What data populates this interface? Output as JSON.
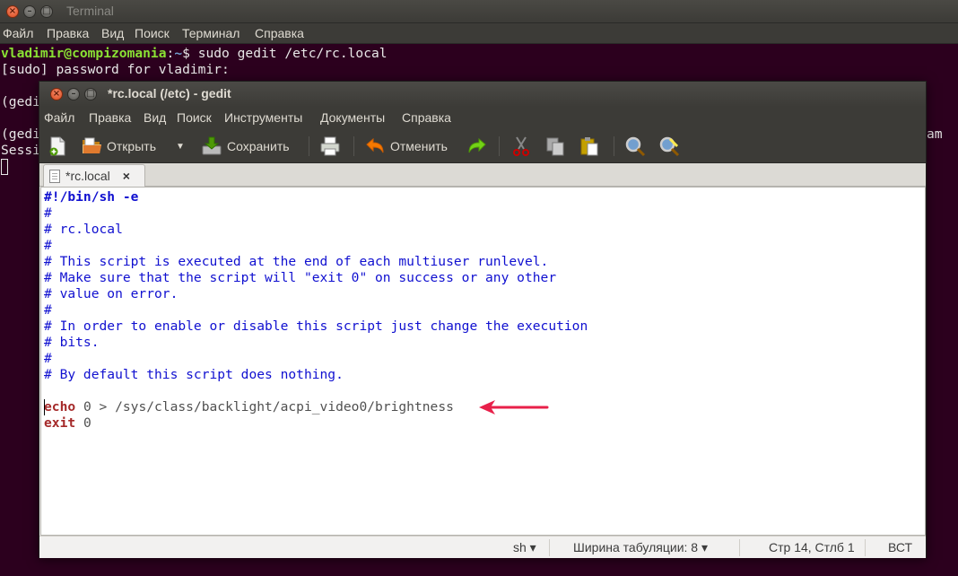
{
  "terminal": {
    "title": "Terminal",
    "menu": [
      "Файл",
      "Правка",
      "Вид",
      "Поиск",
      "Терминал",
      "Справка"
    ],
    "prompt_user": "vladimir@compizomania",
    "prompt_sep": ":",
    "prompt_path": "~",
    "prompt_sym": "$",
    "command": " sudo gedit /etc/rc.local",
    "line2": "[sudo] password for vladimir:",
    "line4": "(gedi",
    "line6": "(gedi",
    "line7": "Sessi",
    "right_fragment": "am"
  },
  "gedit": {
    "title": "*rc.local (/etc) - gedit",
    "menu": [
      "Файл",
      "Правка",
      "Вид",
      "Поиск",
      "Инструменты",
      "Документы",
      "Справка"
    ],
    "toolbar": {
      "open_label": "Открыть",
      "save_label": "Сохранить",
      "undo_label": "Отменить"
    },
    "tab_label": "*rc.local",
    "tab_close": "×",
    "code": {
      "l1": "#!/bin/sh -e",
      "l2": "#",
      "l3": "# rc.local",
      "l4": "#",
      "l5": "# This script is executed at the end of each multiuser runlevel.",
      "l6": "# Make sure that the script will \"exit 0\" on success or any other",
      "l7": "# value on error.",
      "l8": "#",
      "l9": "# In order to enable or disable this script just change the execution",
      "l10": "# bits.",
      "l11": "#",
      "l12": "# By default this script does nothing.",
      "l14_kw": "echo",
      "l14_rest": " 0 > /sys/class/backlight/acpi_video0/brightness",
      "l15_kw": "exit",
      "l15_rest": " 0"
    },
    "status": {
      "language": "sh ▾",
      "tab_width": "Ширина табуляции:  8 ▾",
      "position": "Стр 14, Стлб 1",
      "mode": "ВСТ"
    }
  },
  "colors": {
    "terminal_bg": "#2c001e",
    "comment": "#1010d0",
    "keyword": "#a52a2a",
    "annotation_arrow": "#e8204a"
  }
}
